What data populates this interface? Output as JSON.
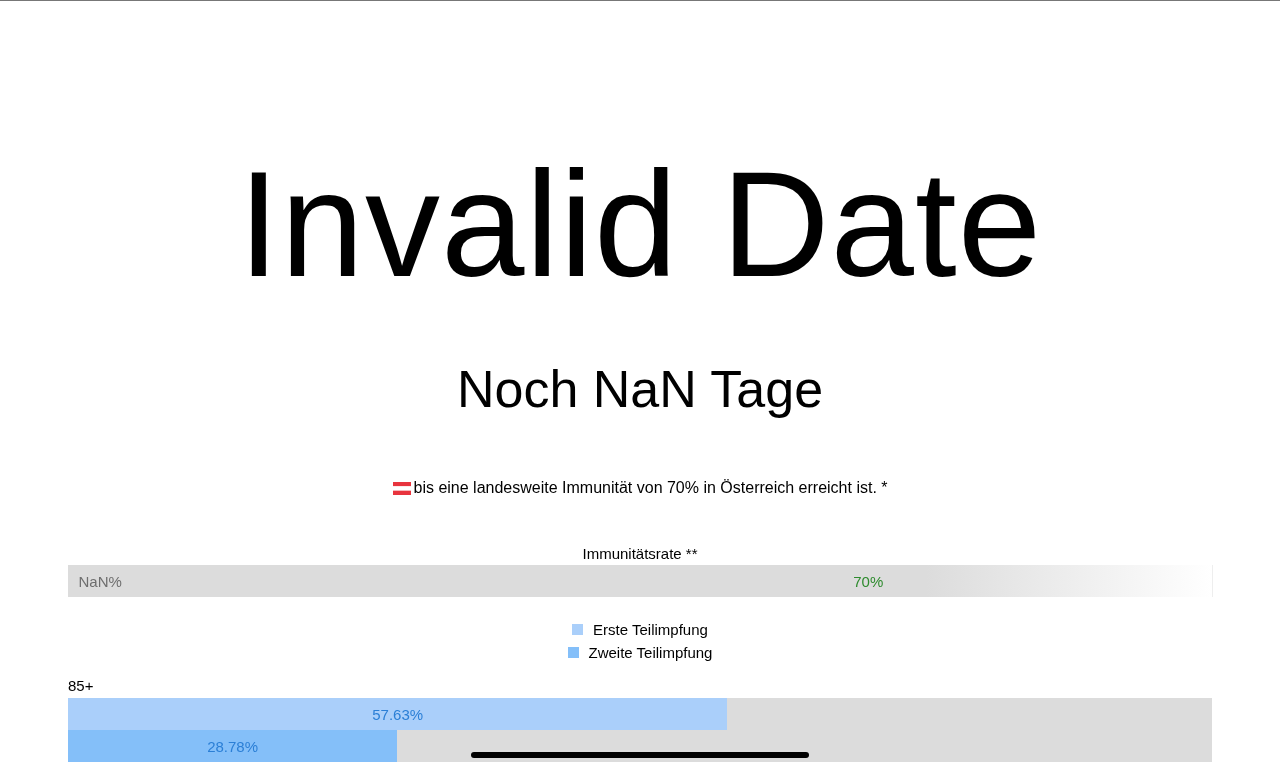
{
  "date_title": "Invalid Date",
  "countdown": "Noch NaN Tage",
  "subtitle": "bis eine landesweite Immunität von 70% in Österreich erreicht ist. *",
  "immunity": {
    "label": "Immunitätsrate **",
    "value_text": "NaN%",
    "target_text": "70%"
  },
  "legend": [
    {
      "label": "Erste Teilimpfung",
      "color": "#aacffa"
    },
    {
      "label": "Zweite Teilimpfung",
      "color": "#84bff9"
    }
  ],
  "age_groups": [
    {
      "label": "85+",
      "bars": [
        {
          "level": 0.5763,
          "text": "57.63%"
        },
        {
          "level": 0.2878,
          "text": "28.78%"
        }
      ]
    }
  ]
}
